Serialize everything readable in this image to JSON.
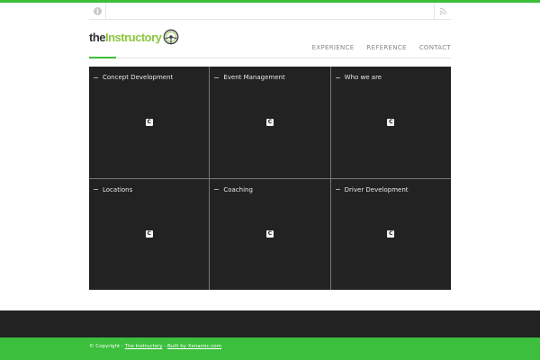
{
  "utility": {
    "info_icon": "i",
    "rss_icon": "rss-icon"
  },
  "logo": {
    "part1": "the",
    "part2": "Instructory"
  },
  "nav": {
    "items": [
      {
        "label": "EXPERIENCE"
      },
      {
        "label": "REFERENCE"
      },
      {
        "label": "CONTACT"
      }
    ]
  },
  "tiles": [
    {
      "title": "Concept Development",
      "icon": "C"
    },
    {
      "title": "Event Management",
      "icon": "C"
    },
    {
      "title": "Who we are",
      "icon": "C"
    },
    {
      "title": "Locations",
      "icon": "C"
    },
    {
      "title": "Coaching",
      "icon": "C"
    },
    {
      "title": "Driver Development",
      "icon": "C"
    }
  ],
  "footer": {
    "copyright": "© Copyright - ",
    "site_link": "The Instructory",
    "separator": " - ",
    "built_link": "Built by Xxnamic.com"
  },
  "colors": {
    "accent_green": "#3cbf3c",
    "logo_green": "#8dc63f",
    "tile_bg": "#222222"
  }
}
